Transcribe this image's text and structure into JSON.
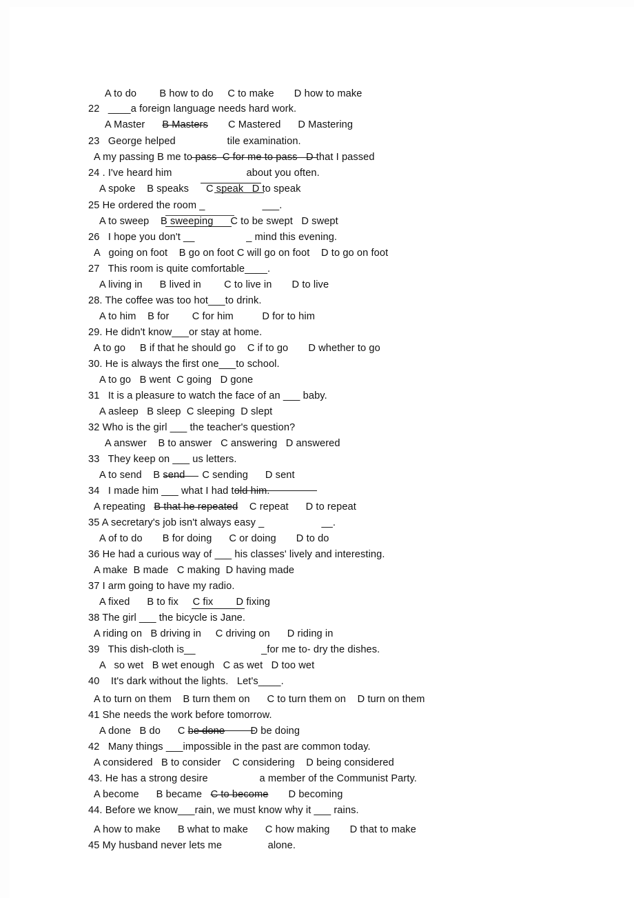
{
  "document": {
    "type": "scanned-worksheet",
    "subject": "English grammar multiple choice",
    "ink_color": "#111111",
    "paper_color": "#ffffff"
  },
  "questions": [
    {
      "number": "",
      "stem": "",
      "options_line": "A to do        B how to do     C to make       D how to make",
      "stem_indent": "i2",
      "options_indent": "i3"
    },
    {
      "number": "22",
      "stem": "22   ____a foreign language needs hard work.",
      "options_line": "A Master      B Masters       C Mastered      D Mastering",
      "stem_indent": "i0",
      "options_indent": "i3"
    },
    {
      "number": "23",
      "stem": "23   George helped                  tile examination.",
      "options_line": "A my passing B me to pass  C for me to pass   D that I passed",
      "stem_indent": "i0",
      "options_indent": "i1"
    },
    {
      "number": "24",
      "stem": "24 . I've heard him                          about you often.",
      "options_line": "A spoke    B speaks      C speak   D to speak",
      "stem_indent": "i0",
      "options_indent": "i2"
    },
    {
      "number": "25",
      "stem": "25 He ordered the room _                    ___.",
      "options_line": "A to sweep    B sweeping      C to be swept   D swept",
      "stem_indent": "i0",
      "options_indent": "i2"
    },
    {
      "number": "26",
      "stem": "26   I hope you don't __                  _ mind this evening.",
      "options_line": "A   going on foot    B go on foot C will go on foot    D to go on foot",
      "stem_indent": "i0",
      "options_indent": "i1"
    },
    {
      "number": "27",
      "stem": "27   This room is quite comfortable____.",
      "options_line": "A living in      B lived in        C to live in       D to live",
      "stem_indent": "i0",
      "options_indent": "i2"
    },
    {
      "number": "28",
      "stem": "28. The coffee was too hot___to drink.",
      "options_line": "A to him    B for        C for him          D for to him",
      "stem_indent": "i0",
      "options_indent": "i2"
    },
    {
      "number": "29",
      "stem": "29. He didn't know___or stay at home.",
      "options_line": "A to go     B if that he should go    C if to go       D whether to go",
      "stem_indent": "i0",
      "options_indent": "i1"
    },
    {
      "number": "30",
      "stem": "30. He is always the first one___to school.",
      "options_line": "A to go   B went  C going   D gone",
      "stem_indent": "i0",
      "options_indent": "i2"
    },
    {
      "number": "31",
      "stem": "31   It is a pleasure to watch the face of an ___ baby.",
      "options_line": "A asleep   B sleep  C sleeping  D slept",
      "stem_indent": "i0",
      "options_indent": "i2"
    },
    {
      "number": "32",
      "stem": "32 Who is the girl ___ the teacher's question?",
      "options_line": "A answer    B to answer   C answering   D answered",
      "stem_indent": "i0",
      "options_indent": "i3"
    },
    {
      "number": "33",
      "stem": "33   They keep on ___ us letters.",
      "options_line": "A to send    B send      C sending      D sent",
      "stem_indent": "i0",
      "options_indent": "i2"
    },
    {
      "number": "34",
      "stem": "34   I made him ___ what I had told him.",
      "options_line": "A repeating   B that he repeated    C repeat      D to repeat",
      "stem_indent": "i0",
      "options_indent": "i1"
    },
    {
      "number": "35",
      "stem": "35 A secretary's job isn't always easy _                    __.",
      "options_line": "A of to do       B for doing      C or doing       D to do",
      "stem_indent": "i0",
      "options_indent": "i2"
    },
    {
      "number": "36",
      "stem": "36 He had a curious way of ___ his classes' lively and interesting.",
      "options_line": "A make  B made   C making  D having made",
      "stem_indent": "i0",
      "options_indent": "i1"
    },
    {
      "number": "37",
      "stem": "37 I arm going to have my radio.",
      "options_line": "A fixed      B to fix     C fix        D fixing",
      "stem_indent": "i0",
      "options_indent": "i2"
    },
    {
      "number": "38",
      "stem": "38 The girl ___ the bicycle is Jane.",
      "options_line": "A riding on   B driving in     C driving on      D riding in",
      "stem_indent": "i0",
      "options_indent": "i1"
    },
    {
      "number": "39",
      "stem": "39   This dish-cloth is__                       _for me to- dry the dishes.",
      "options_line": "A   so wet   B wet enough   C as wet   D too wet",
      "stem_indent": "i0",
      "options_indent": "i2"
    },
    {
      "number": "40",
      "stem": "40    It's dark without the lights.   Let's____.",
      "options_line": "A to turn on them    B turn them on      C to turn them on    D turn on them",
      "stem_indent": "i0",
      "options_indent": "i1"
    },
    {
      "number": "41",
      "stem": "41 She needs the work before tomorrow.",
      "options_line": "A done   B do      C be done         D be doing",
      "stem_indent": "i0",
      "options_indent": "i2"
    },
    {
      "number": "42",
      "stem": "42   Many things ___impossible in the past are common today.",
      "options_line": "A considered   B to consider    C considering    D being considered",
      "stem_indent": "i0",
      "options_indent": "i1"
    },
    {
      "number": "43",
      "stem": "43. He has a strong desire                  a member of the Communist Party.",
      "options_line": "A become      B became   C to become       D becoming",
      "stem_indent": "i0",
      "options_indent": "i1"
    },
    {
      "number": "44",
      "stem": "44. Before we know___rain, we must know why it ___ rains.",
      "options_line": "A how to make      B what to make      C how making       D that to make",
      "stem_indent": "i0",
      "options_indent": "i1"
    },
    {
      "number": "45",
      "stem": "45 My husband never lets me                alone.",
      "options_line": "",
      "stem_indent": "i0",
      "options_indent": "i1"
    }
  ]
}
